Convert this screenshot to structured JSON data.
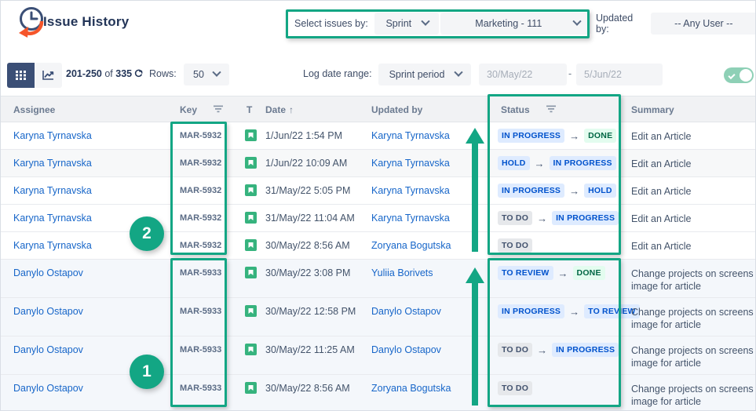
{
  "app": {
    "title": "Issue History",
    "logo_icon": "clock-history-icon"
  },
  "header": {
    "select_issues_label": "Select issues by:",
    "select_type_value": "Sprint",
    "select_board_value": "Marketing - 111",
    "updated_by_label": "Updated by:",
    "updated_by_value": "-- Any User --"
  },
  "toolbar": {
    "grid_view_icon": "grid-view-icon",
    "chart_view_icon": "chart-view-icon",
    "range_text": "201-250",
    "of_text": "of",
    "total_text": "335",
    "refresh_icon": "refresh-icon",
    "rows_label": "Rows:",
    "rows_value": "50",
    "log_date_range_label": "Log date range:",
    "period_value": "Sprint period",
    "date_from_placeholder": "30/May/22",
    "date_to_placeholder": "5/Jun/22",
    "date_separator": "-",
    "toggle_on": true
  },
  "table": {
    "columns": {
      "assignee": "Assignee",
      "key": "Key",
      "type": "T",
      "date": "Date",
      "date_sort": "↑",
      "updated_by": "Updated by",
      "status": "Status",
      "summary": "Summary"
    },
    "filter_icon": "filter-icon",
    "rows": [
      {
        "assignee": "Karyna Tyrnavska",
        "key": "MAR-5932",
        "type_icon": "story-icon",
        "date": "1/Jun/22 1:54 PM",
        "updated_by": "Karyna Tyrnavska",
        "status_from": "IN PROGRESS",
        "status_from_class": "b-inprogress",
        "status_arrow": "→",
        "status_to": "DONE",
        "status_to_class": "b-done",
        "summary": "Edit an Article",
        "bg": "bg-white",
        "height": "h35"
      },
      {
        "assignee": "Karyna Tyrnavska",
        "key": "MAR-5932",
        "type_icon": "story-icon",
        "date": "1/Jun/22 10:09 AM",
        "updated_by": "Karyna Tyrnavska",
        "status_from": "HOLD",
        "status_from_class": "b-hold",
        "status_arrow": "→",
        "status_to": "IN PROGRESS",
        "status_to_class": "b-inprogress",
        "summary": "Edit an Article",
        "bg": "bg-grey",
        "height": "h35"
      },
      {
        "assignee": "Karyna Tyrnavska",
        "key": "MAR-5932",
        "type_icon": "story-icon",
        "date": "31/May/22 5:05 PM",
        "updated_by": "Karyna Tyrnavska",
        "status_from": "IN PROGRESS",
        "status_from_class": "b-inprogress",
        "status_arrow": "→",
        "status_to": "HOLD",
        "status_to_class": "b-hold",
        "summary": "Edit an Article",
        "bg": "bg-white",
        "height": "h35"
      },
      {
        "assignee": "Karyna Tyrnavska",
        "key": "MAR-5932",
        "type_icon": "story-icon",
        "date": "31/May/22 11:04 AM",
        "updated_by": "Karyna Tyrnavska",
        "status_from": "TO DO",
        "status_from_class": "b-todo",
        "status_arrow": "→",
        "status_to": "IN PROGRESS",
        "status_to_class": "b-inprogress",
        "summary": "Edit an Article",
        "bg": "bg-white",
        "height": "h35"
      },
      {
        "assignee": "Karyna Tyrnavska",
        "key": "MAR-5932",
        "type_icon": "story-icon",
        "date": "30/May/22 8:56 AM",
        "updated_by": "Zoryana Bogutska",
        "status_from": "TO DO",
        "status_from_class": "b-todo",
        "status_arrow": "",
        "status_to": "",
        "status_to_class": "",
        "summary": "Edit an Article",
        "bg": "bg-white",
        "height": "h35"
      },
      {
        "assignee": "Danylo Ostapov",
        "key": "MAR-5933",
        "type_icon": "story-icon",
        "date": "30/May/22 3:08 PM",
        "updated_by": "Yuliia Borivets",
        "status_from": "TO REVIEW",
        "status_from_class": "b-toreview",
        "status_arrow": "→",
        "status_to": "DONE",
        "status_to_class": "b-done",
        "summary": "Change projects on screens image for article",
        "bg": "bg-blue",
        "height": "h49"
      },
      {
        "assignee": "Danylo Ostapov",
        "key": "MAR-5933",
        "type_icon": "story-icon",
        "date": "30/May/22 12:58 PM",
        "updated_by": "Danylo Ostapov",
        "status_from": "IN PROGRESS",
        "status_from_class": "b-inprogress",
        "status_arrow": "→",
        "status_to": "TO REVIEW",
        "status_to_class": "b-toreview",
        "summary": "Change projects on screens image for article",
        "bg": "bg-blue",
        "height": "h49"
      },
      {
        "assignee": "Danylo Ostapov",
        "key": "MAR-5933",
        "type_icon": "story-icon",
        "date": "30/May/22 11:25 AM",
        "updated_by": "Danylo Ostapov",
        "status_from": "TO DO",
        "status_from_class": "b-todo",
        "status_arrow": "→",
        "status_to": "IN PROGRESS",
        "status_to_class": "b-inprogress",
        "summary": "Change projects on screens image for article",
        "bg": "bg-blue",
        "height": "h49"
      },
      {
        "assignee": "Danylo Ostapov",
        "key": "MAR-5933",
        "type_icon": "story-icon",
        "date": "30/May/22 8:56 AM",
        "updated_by": "Zoryana Bogutska",
        "status_from": "TO DO",
        "status_from_class": "b-todo",
        "status_arrow": "",
        "status_to": "",
        "status_to_class": "",
        "summary": "Change projects on screens image for article",
        "bg": "bg-blue",
        "height": "h49"
      }
    ]
  },
  "annotations": {
    "badge_one": "1",
    "badge_two": "2",
    "highlight_color": "#13a684"
  }
}
